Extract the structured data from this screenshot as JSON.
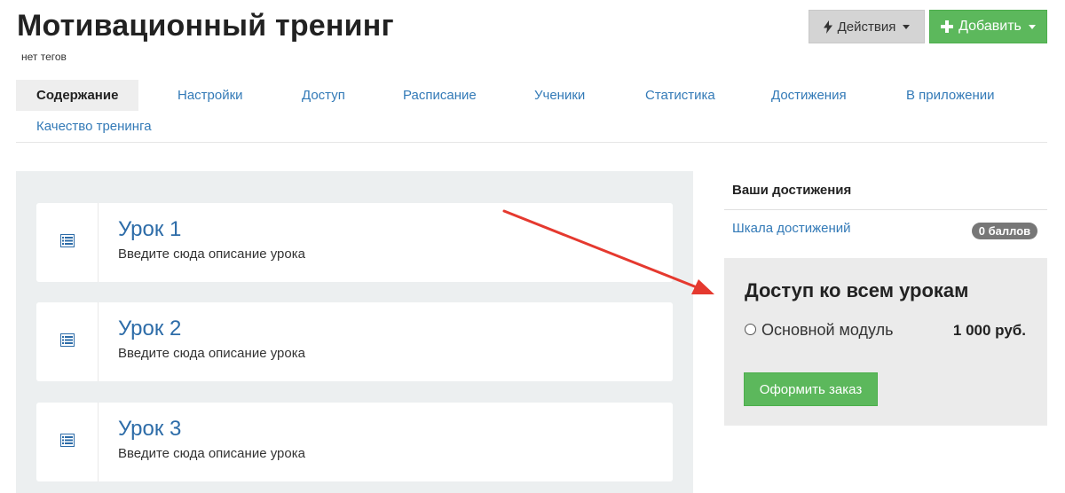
{
  "header": {
    "title": "Мотивационный тренинг",
    "tags": "нет тегов",
    "actions_label": "Действия",
    "add_label": "Добавить"
  },
  "tabs": [
    {
      "label": "Содержание",
      "active": true
    },
    {
      "label": "Настройки"
    },
    {
      "label": "Доступ"
    },
    {
      "label": "Расписание"
    },
    {
      "label": "Ученики"
    },
    {
      "label": "Статистика"
    },
    {
      "label": "Достижения"
    },
    {
      "label": "В приложении"
    },
    {
      "label": "Качество тренинга"
    }
  ],
  "lessons": [
    {
      "title": "Урок 1",
      "description": "Введите сюда описание урока"
    },
    {
      "title": "Урок 2",
      "description": "Введите сюда описание урока"
    },
    {
      "title": "Урок 3",
      "description": "Введите сюда описание урока"
    }
  ],
  "achievements": {
    "title": "Ваши достижения",
    "link": "Шкала достижений",
    "badge": "0 баллов"
  },
  "access": {
    "title": "Доступ ко всем урокам",
    "option_label": "Основной модуль",
    "option_price": "1 000 руб.",
    "order_button": "Оформить заказ"
  },
  "colors": {
    "accent_green": "#5cb85c",
    "link_blue": "#337ab7",
    "annotation_arrow": "#e5392f"
  },
  "icons": {
    "actions": "bolt-icon",
    "add": "plus-icon",
    "lesson": "lesson-list-icon"
  }
}
